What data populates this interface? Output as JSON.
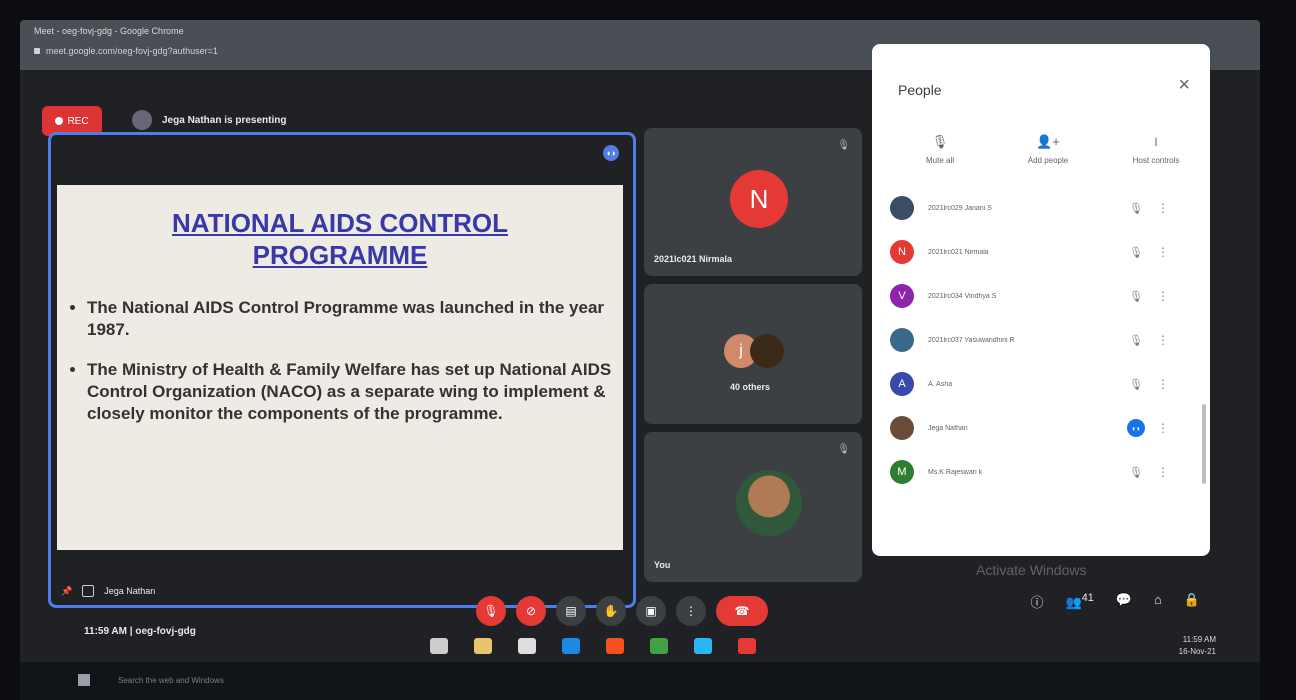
{
  "browser": {
    "title": "Meet - oeg-fovj-gdg - Google Chrome",
    "url": "meet.google.com/oeg-fovj-gdg?authuser=1"
  },
  "meeting": {
    "rec_label": "REC",
    "presenting_text": "Jega Nathan is presenting",
    "presenter_name": "Jega Nathan",
    "time": "11:59 AM",
    "separator": "|",
    "code": "oeg-fovj-gdg"
  },
  "slide": {
    "title_line1": "NATIONAL AIDS CONTROL",
    "title_line2": "PROGRAMME",
    "bullets": [
      "The National AIDS Control Programme was launched in the year 1987.",
      "The Ministry of Health & Family Welfare has set up National AIDS Control Organization (NACO) as a separate wing to implement & closely monitor the components of the programme."
    ]
  },
  "tiles": {
    "tile1": {
      "initial": "N",
      "name": "2021lc021 Nirmala",
      "color": "#e53935"
    },
    "tile2": {
      "initial": "j",
      "label": "40 others"
    },
    "tile3": {
      "name": "You"
    }
  },
  "people_panel": {
    "title": "People",
    "close": "×",
    "actions": [
      {
        "label": "Mute all",
        "icon": "mic-off-icon",
        "glyph": "🎙"
      },
      {
        "label": "Add people",
        "icon": "add-person-icon",
        "glyph": "👤+"
      },
      {
        "label": "Host controls",
        "icon": "toggle-icon",
        "glyph": "⏽"
      }
    ],
    "participants": [
      {
        "name": "2021lrc029 Janani S",
        "initial": "",
        "color": "#3b4d66",
        "state": "muted"
      },
      {
        "name": "2021lrc021 Nirmala",
        "initial": "N",
        "color": "#e53935",
        "state": "muted"
      },
      {
        "name": "2021lrc034 Vindhya S",
        "initial": "V",
        "color": "#8e24aa",
        "state": "muted"
      },
      {
        "name": "2021lrc037 Yasuwandhini R",
        "initial": "",
        "color": "#3a6a8a",
        "state": "muted"
      },
      {
        "name": "A. Asha",
        "initial": "A",
        "color": "#3949ab",
        "state": "muted"
      },
      {
        "name": "Jega Nathan",
        "initial": "",
        "color": "#6b4b3a",
        "state": "speaking"
      },
      {
        "name": "Ms.K.Rajeswari k",
        "initial": "M",
        "color": "#2e7d32",
        "state": "muted"
      }
    ]
  },
  "controls": {
    "icons": [
      "mic-off-icon",
      "camera-off-icon",
      "captions-icon",
      "raise-hand-icon",
      "present-icon",
      "more-options-icon",
      "end-call-icon"
    ],
    "right_icons": [
      "info-icon",
      "people-icon",
      "chat-icon",
      "activities-icon",
      "lock-icon"
    ],
    "people_count": "41"
  },
  "watermark": "Activate Windows",
  "taskbar": {
    "search_placeholder": "Search the web and Windows",
    "clock": "11:59 AM",
    "date": "16-Nov-21"
  }
}
